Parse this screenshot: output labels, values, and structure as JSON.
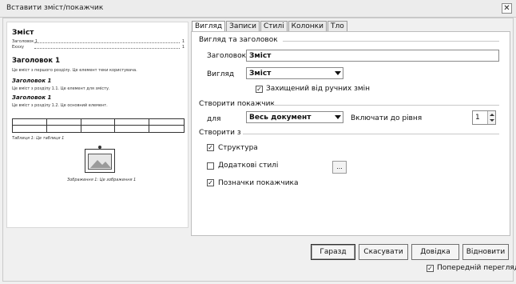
{
  "window": {
    "title": "Вставити зміст/покажчик",
    "close_glyph": "✕"
  },
  "preview": {
    "toc_title": "Зміст",
    "toc_entries": [
      {
        "label": "Заголовок 1",
        "page": "1"
      },
      {
        "label": "Еxxxy",
        "page": "1"
      }
    ],
    "heading1": "Заголовок 1",
    "heading1_text": "Це вміст з першого розділу. Це елемент теки користувача.",
    "heading2a": "Заголовок 1",
    "heading2a_text": "Це вміст з розділу 1.1. Це елемент для змісту.",
    "heading2b": "Заголовок 1",
    "heading2b_text": "Це вміст з розділу 1.2. Це основний елемент.",
    "table_caption": "Таблиця 1: Це таблиця 1",
    "image_caption": "Зображення 1: Це зображення 1"
  },
  "tabs": [
    {
      "label": "Вигляд",
      "active": true
    },
    {
      "label": "Записи",
      "active": false
    },
    {
      "label": "Стилі",
      "active": false
    },
    {
      "label": "Колонки",
      "active": false
    },
    {
      "label": "Тло",
      "active": false
    }
  ],
  "type_section": {
    "heading": "Вигляд та заголовок",
    "title_label": "Заголовок",
    "title_value": "Зміст",
    "type_label": "Вигляд",
    "type_value": "Зміст",
    "protected_label": "Захищений від ручних змін",
    "protected_checked": true
  },
  "create_index": {
    "heading": "Створити покажчик",
    "for_label": "для",
    "for_value": "Весь документ",
    "level_label": "Включати до рівня",
    "level_value": "1"
  },
  "create_from": {
    "heading": "Створити з",
    "outline_label": "Структура",
    "outline_checked": true,
    "extra_styles_label": "Додаткові стилі",
    "extra_styles_checked": false,
    "extra_styles_button": "...",
    "index_marks_label": "Позначки покажчика",
    "index_marks_checked": true
  },
  "buttons": {
    "ok": "Гаразд",
    "cancel": "Скасувати",
    "help": "Довідка",
    "reset": "Відновити"
  },
  "preview_toggle": {
    "label": "Попередній перегляд",
    "checked": true
  }
}
